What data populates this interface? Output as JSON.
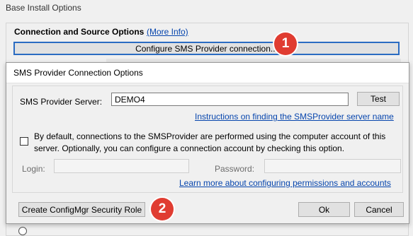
{
  "outer": {
    "title": "Base Install Options",
    "section_heading": "Connection and Source Options",
    "more_info": "(More Info)",
    "configure_button": "Configure SMS Provider connection..."
  },
  "badges": {
    "one": "1",
    "two": "2"
  },
  "dialog": {
    "title": "SMS Provider Connection Options",
    "server_label": "SMS Provider Server:",
    "server_value": "DEMO4",
    "test_button": "Test",
    "instructions_link": "Instructions on finding the SMSProvider server name",
    "checkbox_text": "By default, connections to the SMSProvider are performed using the computer account of this server. Optionally, you can configure a connection account by checking this option.",
    "checkbox_checked": false,
    "login_label": "Login:",
    "login_value": "",
    "password_label": "Password:",
    "password_value": "",
    "permissions_link": "Learn more about configuring permissions and accounts",
    "security_role_button": "Create ConfigMgr Security Role",
    "ok_button": "Ok",
    "cancel_button": "Cancel"
  },
  "colors": {
    "accent": "#2b6cc2",
    "badge": "#e03c31",
    "link": "#0645ad"
  }
}
